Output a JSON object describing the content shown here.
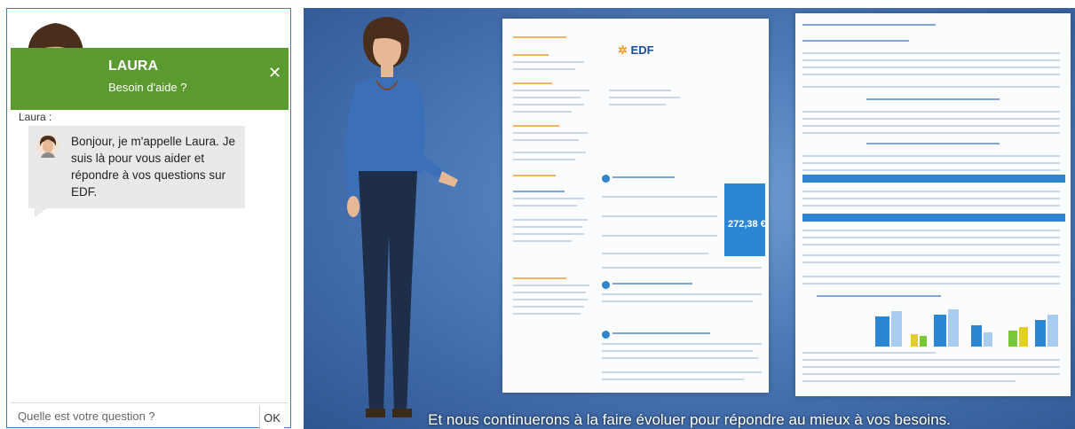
{
  "chat": {
    "name": "LAURA",
    "subtitle": "Besoin d'aide ?",
    "close_icon": "close-icon",
    "speaker": "Laura :",
    "message": "Bonjour, je m'appelle Laura. Je suis là pour vous aider et répondre à vos questions sur EDF.",
    "input_placeholder": "Quelle est votre question ?",
    "ok_label": "OK",
    "colors": {
      "header": "#5a9a2e",
      "bubble": "#e9e9e9",
      "border": "#3a7fbf"
    }
  },
  "video": {
    "logo_text": "EDF",
    "bill_amount": "272,38 €",
    "subtitle": "Et nous continuerons à la faire évoluer pour répondre au mieux à vos besoins.",
    "colors": {
      "background": "#3d6aa8",
      "edf_blue": "#1d4e9a",
      "edf_orange": "#f39a1e"
    }
  }
}
